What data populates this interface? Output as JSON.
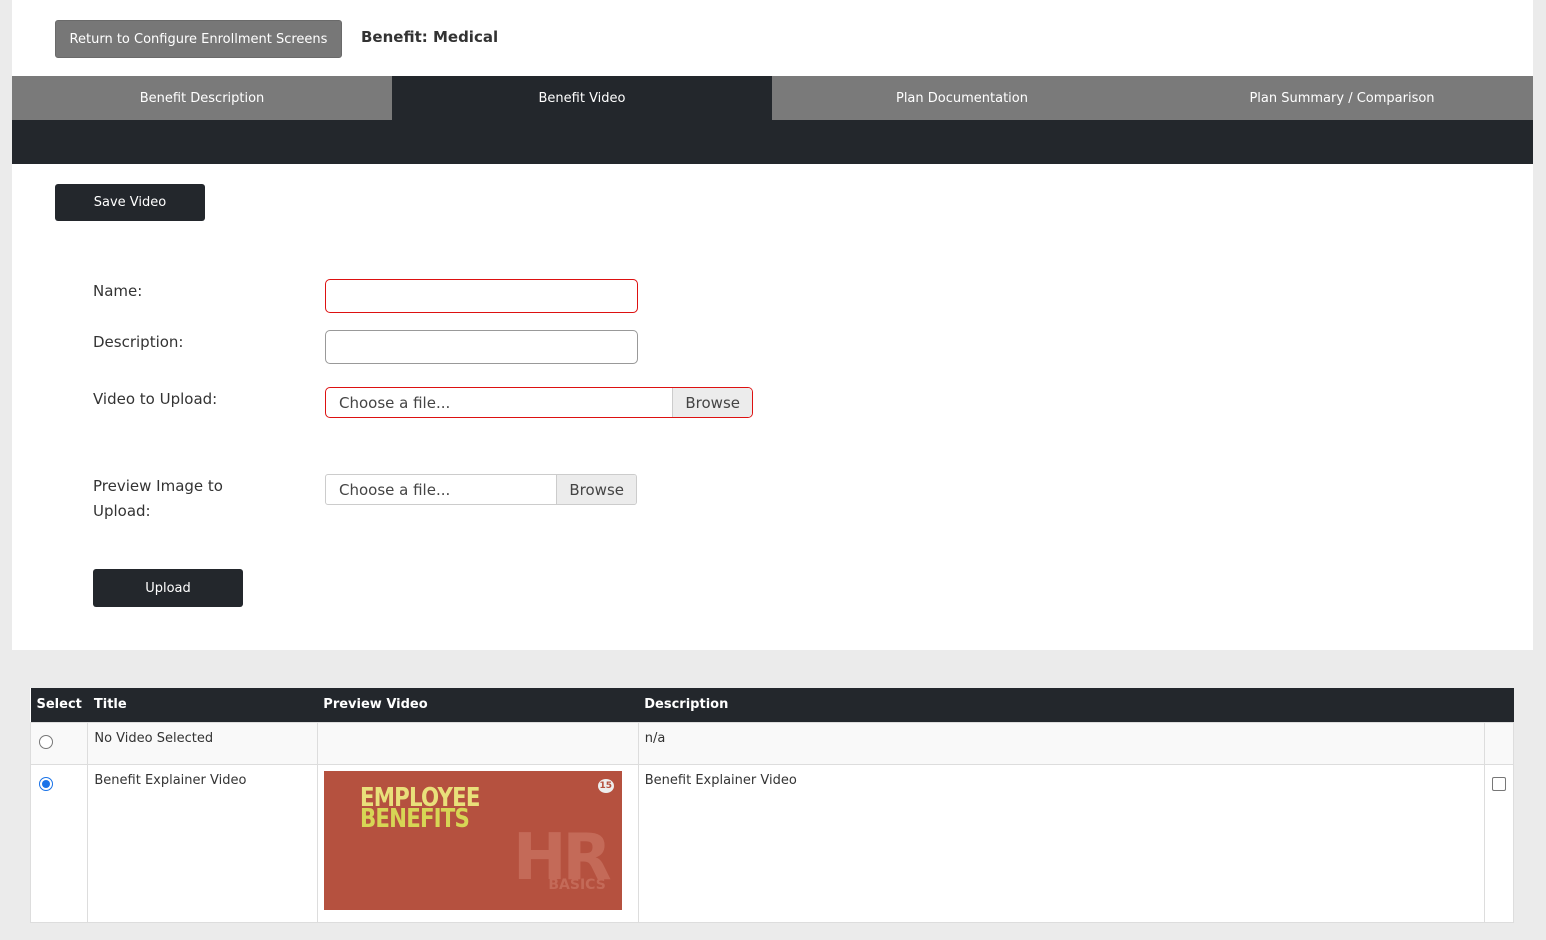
{
  "header": {
    "return_label": "Return to Configure Enrollment Screens",
    "benefit_title": "Benefit: Medical"
  },
  "tabs": [
    {
      "label": "Benefit Description",
      "active": false
    },
    {
      "label": "Benefit Video",
      "active": true
    },
    {
      "label": "Plan Documentation",
      "active": false
    },
    {
      "label": "Plan Summary / Comparison",
      "active": false
    }
  ],
  "form": {
    "save_label": "Save Video",
    "name_label": "Name:",
    "name_value": "",
    "description_label": "Description:",
    "description_value": "",
    "video_label": "Video to Upload:",
    "video_placeholder": "Choose a file...",
    "preview_label": "Preview Image to Upload:",
    "preview_placeholder": "Choose a file...",
    "browse_label": "Browse",
    "upload_label": "Upload"
  },
  "table": {
    "headers": [
      "Select",
      "Title",
      "Preview Video",
      "Description"
    ],
    "rows": [
      {
        "selected": false,
        "title": "No Video Selected",
        "preview": "",
        "description": "n/a"
      },
      {
        "selected": true,
        "title": "Benefit Explainer Video",
        "preview": "thumbnail",
        "description": "Benefit Explainer Video",
        "checked": false
      }
    ],
    "thumbnail": {
      "line1": "EMPLOYEE",
      "line2": "BENEFITS",
      "badge": "15",
      "logo": "HR",
      "logo_sub": "BASICS"
    }
  },
  "colors": {
    "dark": "#23272c",
    "tab_bg": "#7a7a7a",
    "invalid_border": "#dd1111",
    "thumb_bg": "#b5513f",
    "radio_selected": "#1a73e8"
  }
}
